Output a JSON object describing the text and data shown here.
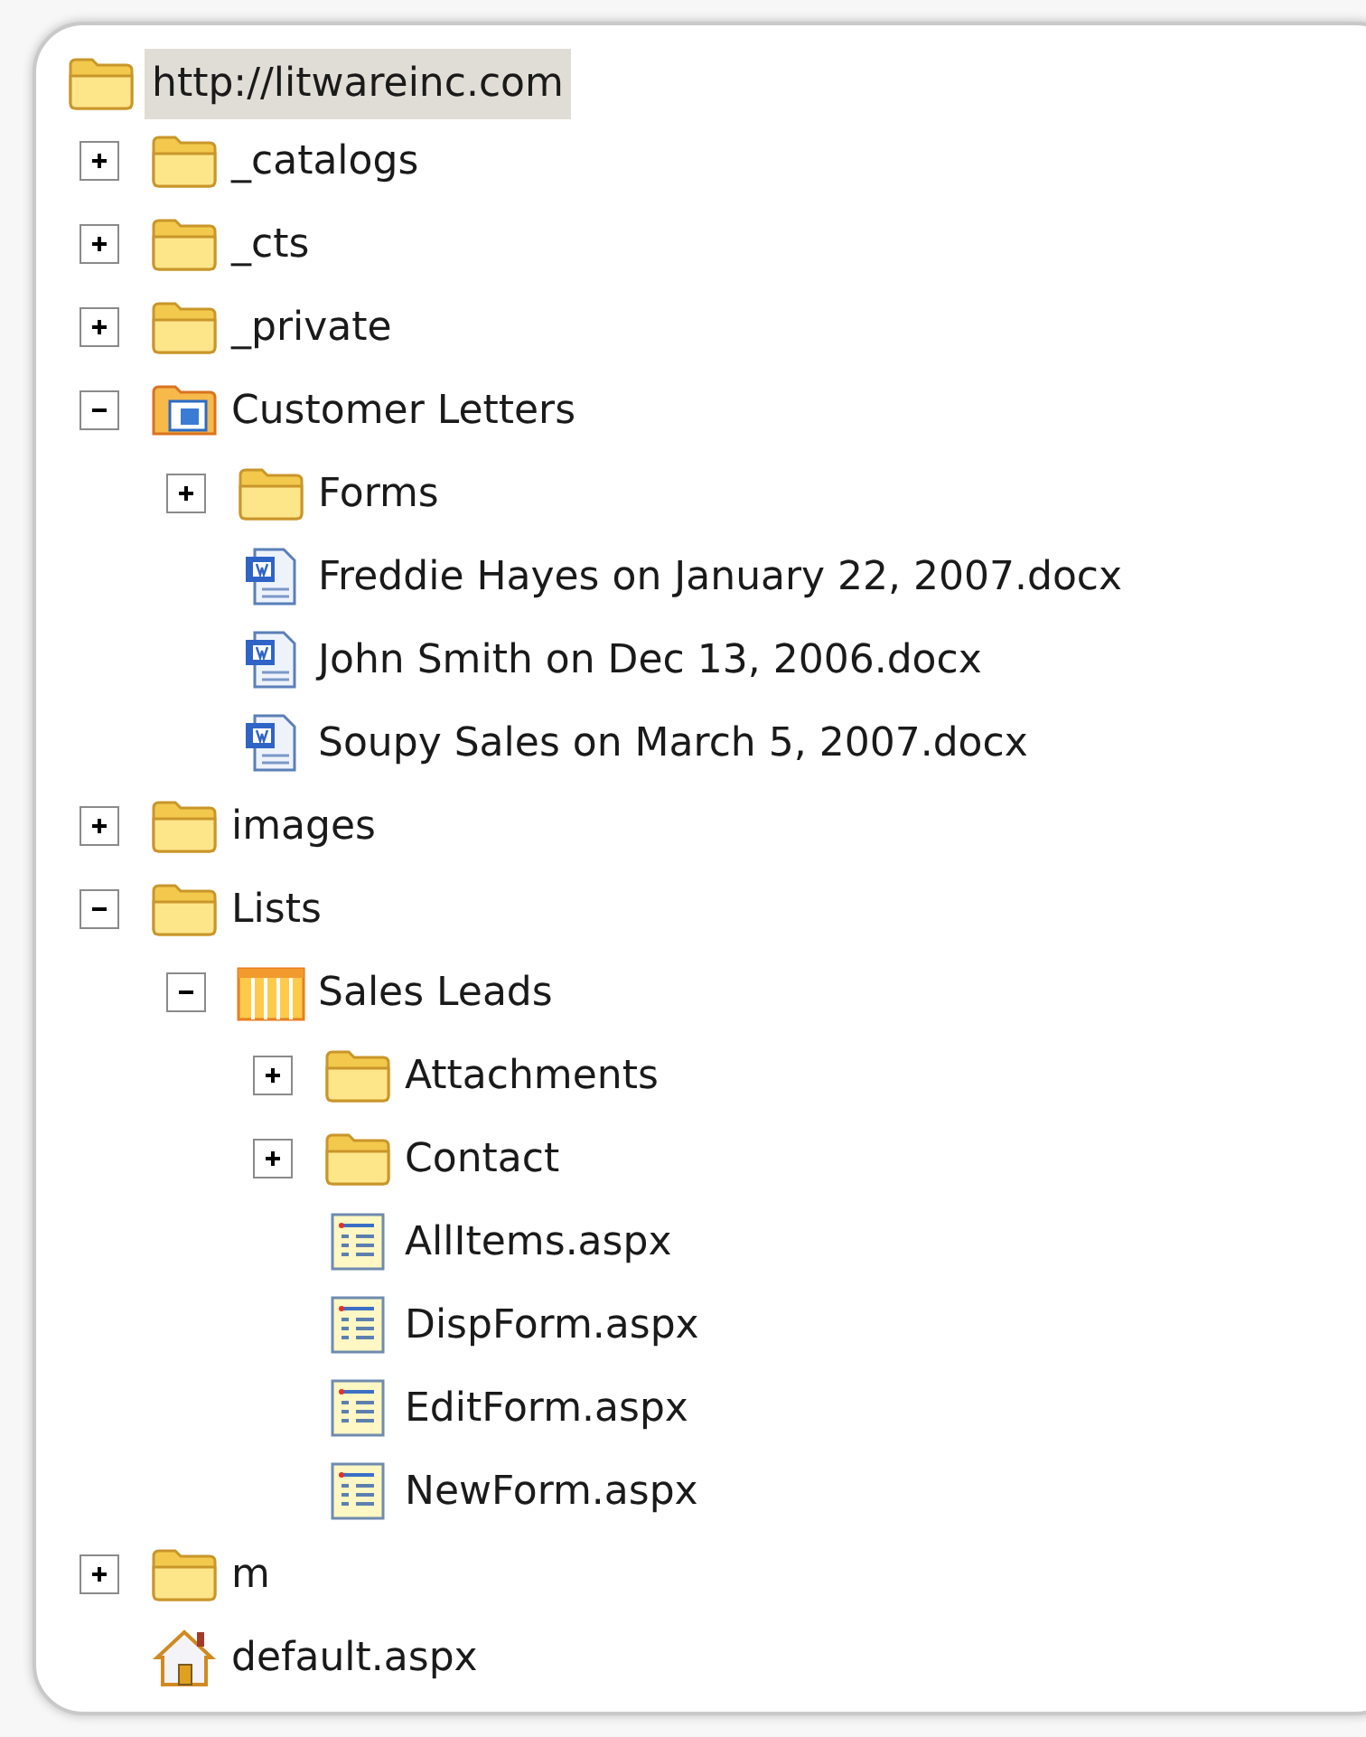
{
  "tree": {
    "root": {
      "label": "http://litwareinc.com",
      "kind": "root",
      "selected": true
    },
    "items": [
      {
        "label": "_catalogs",
        "kind": "folder",
        "expanded": false,
        "selected": false
      },
      {
        "label": "_cts",
        "kind": "folder",
        "expanded": false,
        "selected": false
      },
      {
        "label": "_private",
        "kind": "folder",
        "expanded": false,
        "selected": false
      },
      {
        "label": "Customer Letters",
        "kind": "doclib",
        "expanded": true,
        "selected": false,
        "children": [
          {
            "label": "Forms",
            "kind": "folder",
            "expanded": false,
            "selected": false
          },
          {
            "label": "Freddie Hayes on January 22, 2007.docx",
            "kind": "doc",
            "selected": false
          },
          {
            "label": "John Smith on Dec 13, 2006.docx",
            "kind": "doc",
            "selected": false
          },
          {
            "label": "Soupy Sales on March 5, 2007.docx",
            "kind": "doc",
            "selected": false
          }
        ]
      },
      {
        "label": "images",
        "kind": "folder",
        "expanded": false,
        "selected": false
      },
      {
        "label": "Lists",
        "kind": "folder",
        "expanded": true,
        "selected": false,
        "children": [
          {
            "label": "Sales Leads",
            "kind": "list",
            "expanded": true,
            "selected": false,
            "children": [
              {
                "label": "Attachments",
                "kind": "folder",
                "expanded": false,
                "selected": false
              },
              {
                "label": "Contact",
                "kind": "folder",
                "expanded": false,
                "selected": false
              },
              {
                "label": "AllItems.aspx",
                "kind": "page",
                "selected": false
              },
              {
                "label": "DispForm.aspx",
                "kind": "page",
                "selected": false
              },
              {
                "label": "EditForm.aspx",
                "kind": "page",
                "selected": false
              },
              {
                "label": "NewForm.aspx",
                "kind": "page",
                "selected": false
              }
            ]
          }
        ]
      },
      {
        "label": "m",
        "kind": "folder",
        "expanded": false,
        "selected": false
      },
      {
        "label": "default.aspx",
        "kind": "home",
        "selected": false
      }
    ]
  }
}
